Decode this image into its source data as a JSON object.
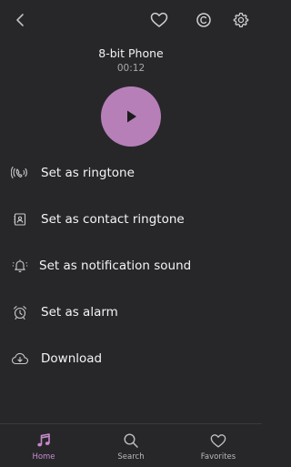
{
  "header": {
    "icons": [
      "back-arrow-icon",
      "heart-icon",
      "copyright-icon",
      "gear-icon"
    ]
  },
  "track": {
    "title": "8-bit Phone",
    "time": "00:12"
  },
  "player": {
    "accent": "#b77fb8"
  },
  "menu": {
    "items": [
      {
        "label": "Set as ringtone",
        "icon": "phone-ring-icon"
      },
      {
        "label": "Set as contact ringtone",
        "icon": "contact-card-icon"
      },
      {
        "label": "Set as notification sound",
        "icon": "bell-icon"
      },
      {
        "label": "Set as alarm",
        "icon": "alarm-clock-icon"
      },
      {
        "label": "Download",
        "icon": "cloud-download-icon"
      }
    ]
  },
  "nav": {
    "items": [
      {
        "label": "Home",
        "icon": "music-note-icon",
        "active": true
      },
      {
        "label": "Search",
        "icon": "search-icon"
      },
      {
        "label": "Favorites",
        "icon": "heart-icon"
      }
    ],
    "active_color": "#c98bcc"
  },
  "colors": {
    "background": "#27272a",
    "text": "#ffffff",
    "muted": "#a8a8ad"
  }
}
